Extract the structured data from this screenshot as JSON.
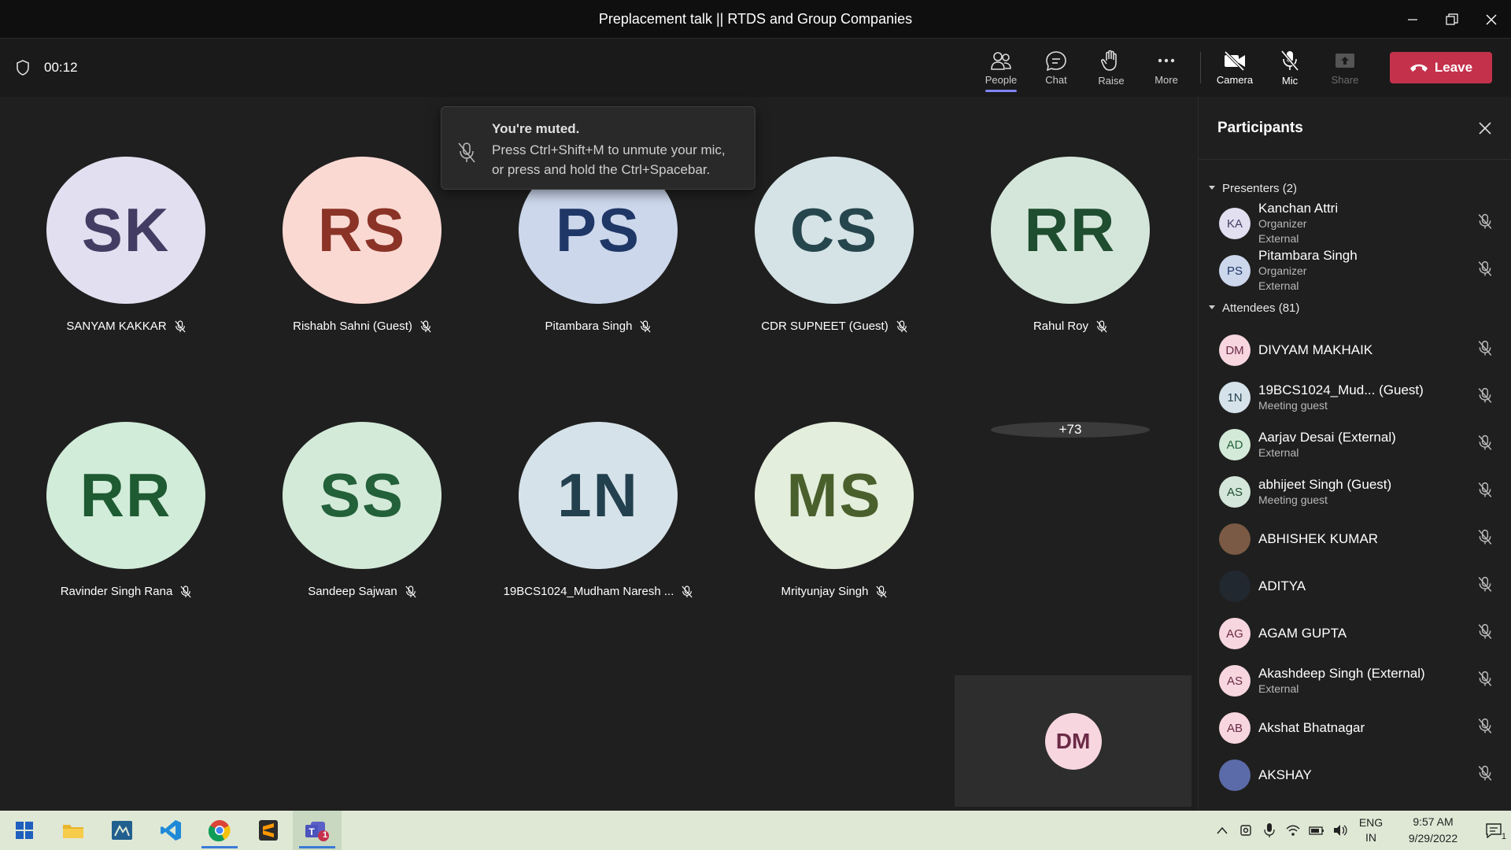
{
  "window": {
    "title": "Preplacement talk || RTDS and Group Companies"
  },
  "toolbar": {
    "timer": "00:12",
    "buttons": {
      "people": "People",
      "chat": "Chat",
      "raise": "Raise",
      "more": "More",
      "camera": "Camera",
      "mic": "Mic",
      "share": "Share"
    },
    "leave": "Leave"
  },
  "toast": {
    "title": "You're muted.",
    "line1": "Press Ctrl+Shift+M to unmute your mic,",
    "line2": "or press and hold the Ctrl+Spacebar."
  },
  "stage": {
    "tiles": [
      {
        "initials": "SK",
        "name": "SANYAM KAKKAR",
        "bg": "#e2dff0",
        "fg": "#433d63"
      },
      {
        "initials": "RS",
        "name": "Rishabh Sahni (Guest)",
        "bg": "#fbd9d3",
        "fg": "#8a3326"
      },
      {
        "initials": "PS",
        "name": "Pitambara Singh",
        "bg": "#ccd7ec",
        "fg": "#1f3766"
      },
      {
        "initials": "CS",
        "name": "CDR SUPNEET (Guest)",
        "bg": "#d5e3e6",
        "fg": "#26464d"
      },
      {
        "initials": "RR",
        "name": "Rahul Roy",
        "bg": "#d4e6da",
        "fg": "#1e4d2f"
      },
      {
        "initials": "RR",
        "name": "Ravinder Singh Rana",
        "bg": "#d1ecd9",
        "fg": "#1e5a32"
      },
      {
        "initials": "SS",
        "name": "Sandeep Sajwan",
        "bg": "#d4ead9",
        "fg": "#23613a"
      },
      {
        "initials": "1N",
        "name": "19BCS1024_Mudham Naresh ...",
        "bg": "#d6e2e9",
        "fg": "#23404f"
      },
      {
        "initials": "MS",
        "name": "Mrityunjay Singh",
        "bg": "#e4eedc",
        "fg": "#49602d"
      }
    ],
    "overflow": "+73",
    "self_initials": "DM"
  },
  "panel": {
    "title": "Participants",
    "presenters_label": "Presenters (2)",
    "attendees_label": "Attendees (81)",
    "presenters": [
      {
        "initials": "KA",
        "name": "Kanchan Attri",
        "sub1": "Organizer",
        "sub2": "External",
        "bg": "#e2dff0",
        "fg": "#433d63"
      },
      {
        "initials": "PS",
        "name": "Pitambara Singh",
        "sub1": "Organizer",
        "sub2": "External",
        "bg": "#ccd7ec",
        "fg": "#1f3766"
      }
    ],
    "attendees": [
      {
        "initials": "DM",
        "name": "DIVYAM MAKHAIK",
        "sub1": "",
        "bg": "#f7d6e0",
        "fg": "#6b2a45"
      },
      {
        "initials": "1N",
        "name": "19BCS1024_Mud... (Guest)",
        "sub1": "Meeting guest",
        "bg": "#d6e2e9",
        "fg": "#23404f"
      },
      {
        "initials": "AD",
        "name": "Aarjav Desai (External)",
        "sub1": "External",
        "bg": "#d4ead9",
        "fg": "#23613a"
      },
      {
        "initials": "AS",
        "name": "abhijeet Singh (Guest)",
        "sub1": "Meeting guest",
        "bg": "#d4e6da",
        "fg": "#1e4d2f"
      },
      {
        "initials": "",
        "name": "ABHISHEK KUMAR",
        "sub1": "",
        "bg": "#7a5a44",
        "fg": "#ffffff"
      },
      {
        "initials": "",
        "name": "ADITYA",
        "sub1": "",
        "bg": "#222830",
        "fg": "#ffffff"
      },
      {
        "initials": "AG",
        "name": "AGAM GUPTA",
        "sub1": "",
        "bg": "#f7d6e0",
        "fg": "#6b2a45"
      },
      {
        "initials": "AS",
        "name": "Akashdeep Singh (External)",
        "sub1": "External",
        "bg": "#f7d6e0",
        "fg": "#6b2a45"
      },
      {
        "initials": "AB",
        "name": "Akshat Bhatnagar",
        "sub1": "",
        "bg": "#f7d6e0",
        "fg": "#6b2a45"
      },
      {
        "initials": "",
        "name": "AKSHAY",
        "sub1": "",
        "bg": "#5b6aa8",
        "fg": "#ffffff"
      }
    ]
  },
  "taskbar": {
    "lang1": "ENG",
    "lang2": "IN",
    "time": "9:57 AM",
    "date": "9/29/2022",
    "teams_badge": "1",
    "notif_badge": "1"
  },
  "colors": {
    "leave": "#c4314b",
    "accent": "#7f85f5",
    "taskbar": "#dfe8d5"
  }
}
